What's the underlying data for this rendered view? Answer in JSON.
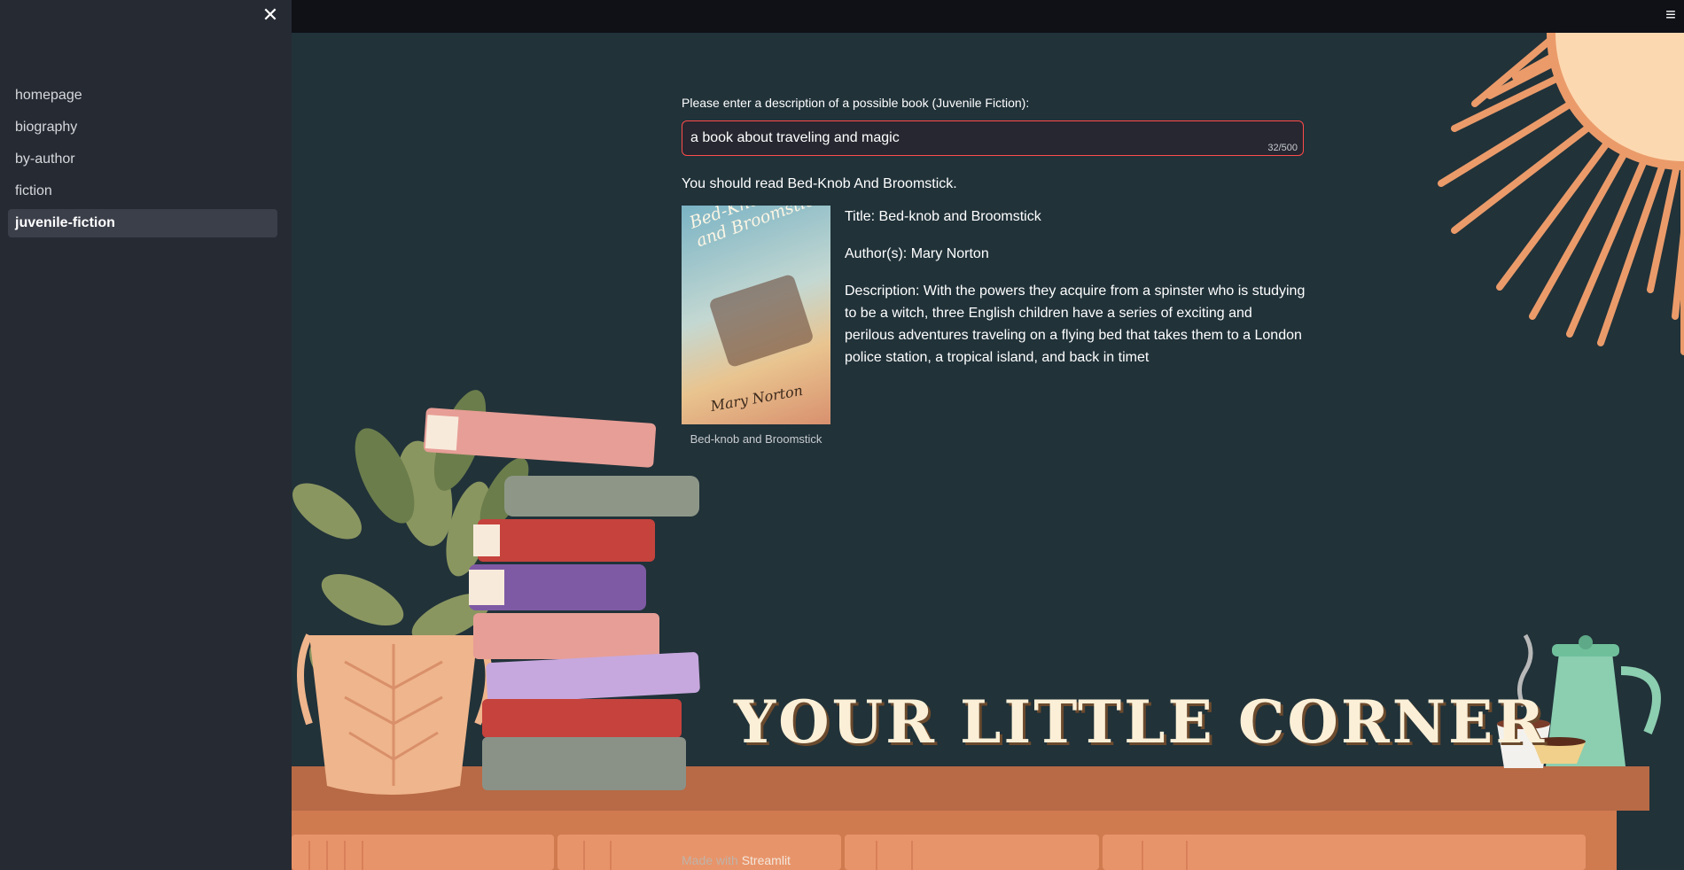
{
  "sidebar": {
    "items": [
      {
        "label": "homepage",
        "active": false
      },
      {
        "label": "biography",
        "active": false
      },
      {
        "label": "by-author",
        "active": false
      },
      {
        "label": "fiction",
        "active": false
      },
      {
        "label": "juvenile-fiction",
        "active": true
      }
    ],
    "close_icon": "close-icon"
  },
  "header": {
    "menu_icon": "hamburger-menu-icon"
  },
  "form": {
    "label": "Please enter a description of a possible book (Juvenile Fiction):",
    "value": "a book about traveling and magic",
    "counter": "32/500"
  },
  "result": {
    "suggestion": "You should read Bed-Knob And Broomstick.",
    "caption": "Bed-knob and Broomstick",
    "title": "Title: Bed-knob and Broomstick",
    "authors": "Author(s): Mary Norton",
    "description": "Description: With the powers they acquire from a spinster who is studying to be a witch, three English children have a series of exciting and perilous adventures traveling on a flying bed that takes them to a London police station, a tropical island, and back in timet",
    "cover": {
      "title_line1": "Bed-Knob",
      "title_line2": "and Broomstick",
      "author": "Mary Norton"
    }
  },
  "banner": {
    "text": "YOUR LITTLE CORNER"
  },
  "footer": {
    "prefix": "Made with",
    "brand": "Streamlit"
  },
  "colors": {
    "background": "#213239",
    "sidebar": "#262a33",
    "accent": "#ff4b4b",
    "sun": "#eb9b6a",
    "shelf": "#b76a45"
  }
}
